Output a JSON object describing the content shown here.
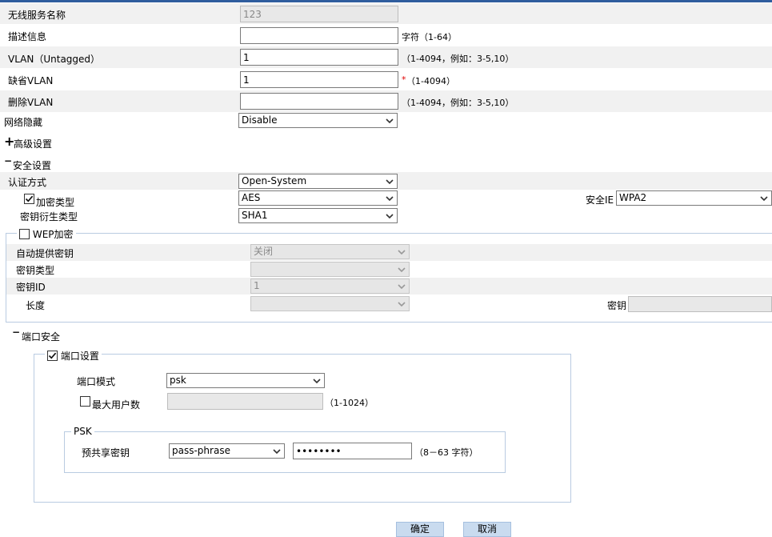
{
  "form": {
    "ssid_label": "无线服务名称",
    "ssid_value": "123",
    "desc_label": "描述信息",
    "desc_value": "",
    "desc_hint": "字符（1-64）",
    "vlan_label": "VLAN（Untagged）",
    "vlan_value": "1",
    "vlan_hint": "（1-4094，例如：3-5,10）",
    "default_vlan_label": "缺省VLAN",
    "default_vlan_value": "1",
    "default_vlan_req": "*",
    "default_vlan_hint": "（1-4094）",
    "delete_vlan_label": "删除VLAN",
    "delete_vlan_value": "",
    "delete_vlan_hint": "（1-4094，例如：3-5,10）",
    "hide_label": "网络隐藏",
    "hide_value": "Disable"
  },
  "advanced": {
    "toggle": "+",
    "label": "高级设置"
  },
  "security": {
    "toggle": "−",
    "label": "安全设置",
    "auth_label": "认证方式",
    "auth_value": "Open-System",
    "cipher_label": "加密类型",
    "cipher_checked": true,
    "cipher_value": "AES",
    "ie_label": "安全IE",
    "ie_value": "WPA2",
    "kdf_label": "密钥衍生类型",
    "kdf_value": "SHA1"
  },
  "wep": {
    "legend": "WEP加密",
    "checked": false,
    "auto_key_label": "自动提供密钥",
    "auto_key_value": "关闭",
    "key_type_label": "密钥类型",
    "key_type_value": "",
    "key_id_label": "密钥ID",
    "key_id_value": "1",
    "length_label": "长度",
    "length_value": "",
    "key_label": "密钥",
    "key_value": ""
  },
  "port_security": {
    "toggle": "−",
    "label": "端口安全",
    "settings_legend": "端口设置",
    "settings_checked": true,
    "mode_label": "端口模式",
    "mode_value": "psk",
    "max_users_label": "最大用户数",
    "max_users_checked": false,
    "max_users_value": "",
    "max_users_hint": "（1-1024）",
    "psk_legend": "PSK",
    "psk_label": "预共享密钥",
    "psk_type_value": "pass-phrase",
    "psk_value": "12345678",
    "psk_hint": "（8－63 字符）"
  },
  "buttons": {
    "ok": "确定",
    "cancel": "取消"
  },
  "colors": {
    "topbar": "#2f5d9e",
    "button": "#c9dbef",
    "fieldset_border": "#b9cbe1",
    "required": "#e00000"
  }
}
